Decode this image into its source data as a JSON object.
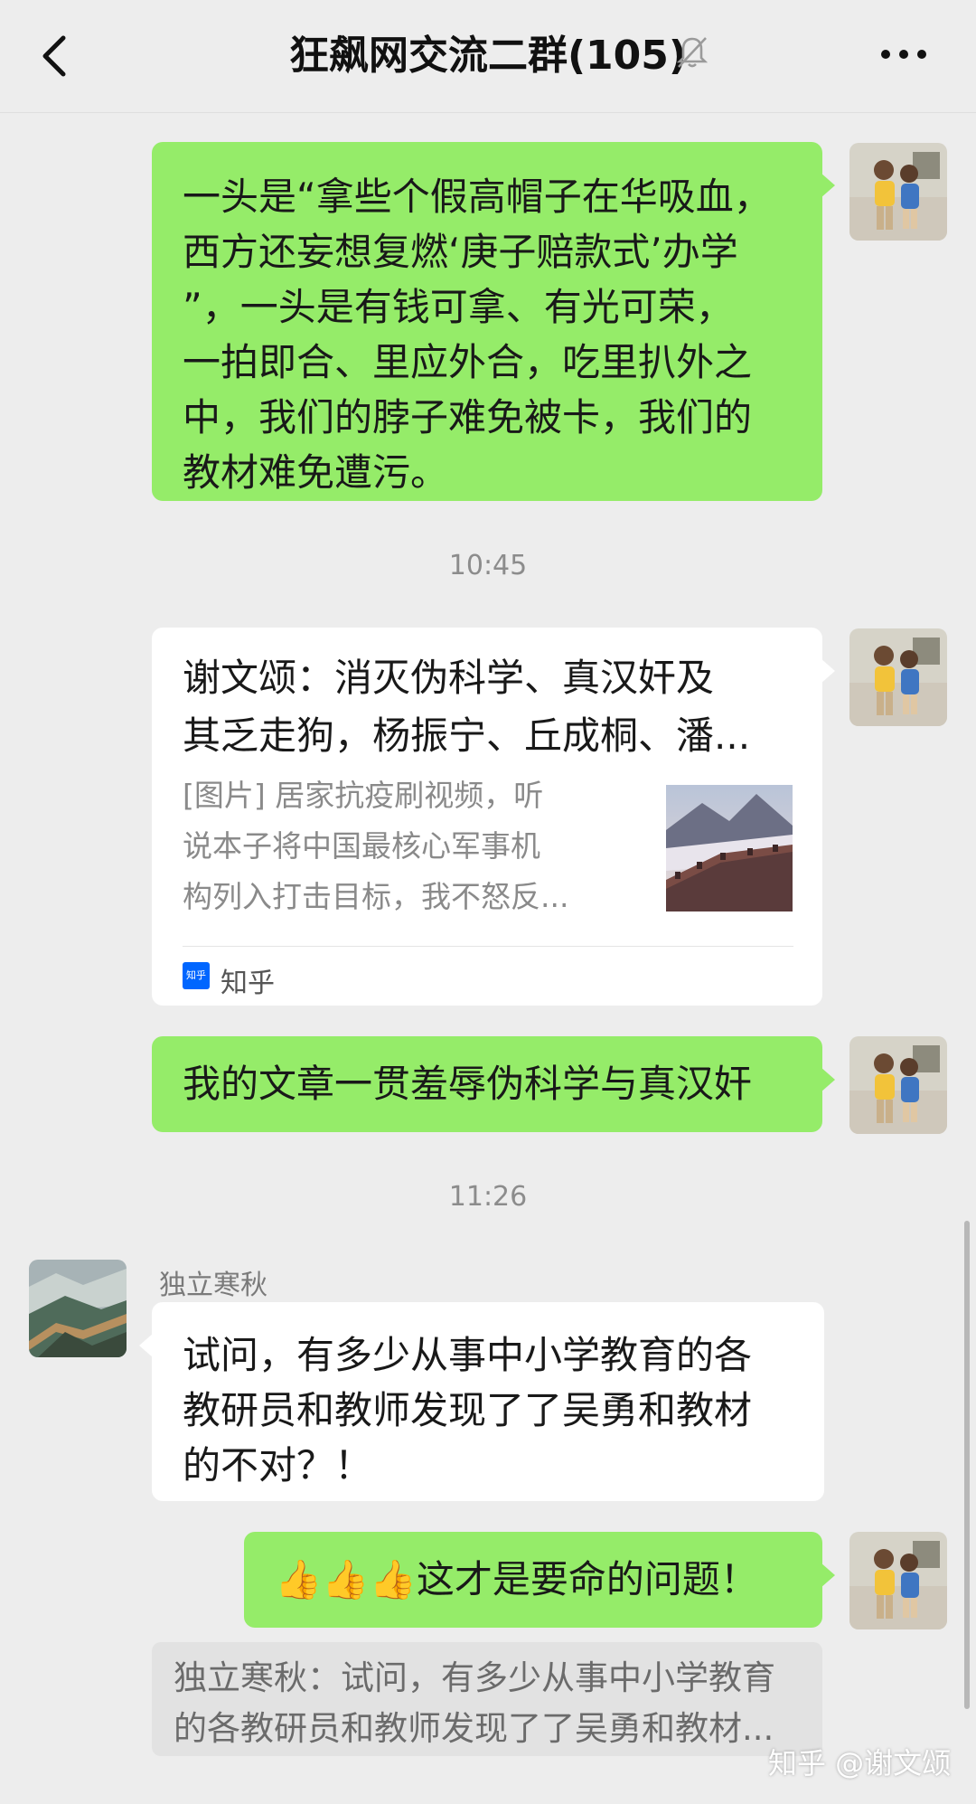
{
  "header": {
    "title": "狂飙网交流二群(105)"
  },
  "messages": {
    "m1": {
      "lines": [
        "一头是“拿些个假高帽子在华吸血，",
        "西方还妄想复燃‘庚子赔款式’办学",
        "”，一头是有钱可拿、有光可荣，",
        "一拍即合、里应外合，吃里扒外之",
        "中，我们的脖子难免被卡，我们的",
        "教材难免遭污。"
      ]
    },
    "time1": "10:45",
    "card": {
      "title_lines": [
        "谢文颂：消灭伪科学、真汉奸及",
        "其乏走狗，杨振宁、丘成桐、潘..."
      ],
      "desc_lines": [
        "[图片] 居家抗疫刷视频，听",
        "说本子将中国最核心军事机",
        "构列入打击目标，我不怒反..."
      ],
      "source_icon_text": "知乎",
      "source": "知乎"
    },
    "m3": "我的文章一贯羞辱伪科学与真汉奸",
    "time2": "11:26",
    "m4": {
      "sender": "独立寒秋",
      "lines": [
        "试问，有多少从事中小学教育的各",
        "教研员和教师发现了了吴勇和教材",
        "的不对？！"
      ]
    },
    "m5": {
      "emoji": "👍👍👍",
      "text": "这才是要命的问题！"
    },
    "quote": {
      "lines": [
        "独立寒秋：试问，有多少从事中小学教育",
        "的各教研员和教师发现了了吴勇和教材..."
      ]
    }
  },
  "watermark": "知乎 @谢文颂",
  "colors": {
    "background": "#ededed",
    "sent_bubble": "#95ec69",
    "received_bubble": "#ffffff",
    "zhihu_blue": "#0066ff"
  },
  "icons": {
    "back": "chevron-left-icon",
    "mute": "bell-off-icon",
    "more": "more-dots-icon"
  }
}
